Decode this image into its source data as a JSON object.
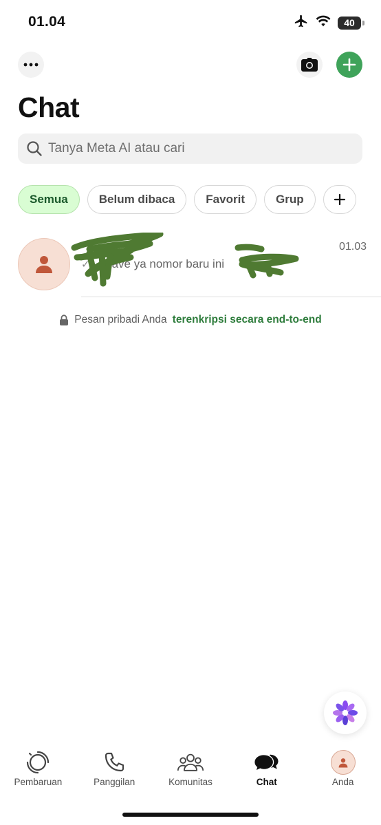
{
  "status_bar": {
    "time": "01.04",
    "battery": "40"
  },
  "header": {
    "title": "Chat"
  },
  "search": {
    "placeholder": "Tanya Meta AI atau cari"
  },
  "filters": [
    {
      "label": "Semua",
      "active": true
    },
    {
      "label": "Belum dibaca",
      "active": false
    },
    {
      "label": "Favorit",
      "active": false
    },
    {
      "label": "Grup",
      "active": false
    }
  ],
  "chat_list": [
    {
      "name": "",
      "time": "01.03",
      "preview": "ave ya nomor baru ini",
      "status": "sent"
    }
  ],
  "encryption": {
    "text": "Pesan pribadi Anda",
    "link": "terenkripsi secara end-to-end"
  },
  "tabs": [
    {
      "label": "Pembaruan",
      "icon": "status-icon"
    },
    {
      "label": "Panggilan",
      "icon": "phone-icon"
    },
    {
      "label": "Komunitas",
      "icon": "community-icon"
    },
    {
      "label": "Chat",
      "icon": "chat-bubbles-icon",
      "active": true
    },
    {
      "label": "Anda",
      "icon": "avatar-icon"
    }
  ],
  "colors": {
    "accent": "#3fa35a",
    "chip_active_bg": "#d9fdd3",
    "link": "#2f7d3d",
    "avatar_bg": "#f7dfd4",
    "avatar_fg": "#c0573a"
  }
}
